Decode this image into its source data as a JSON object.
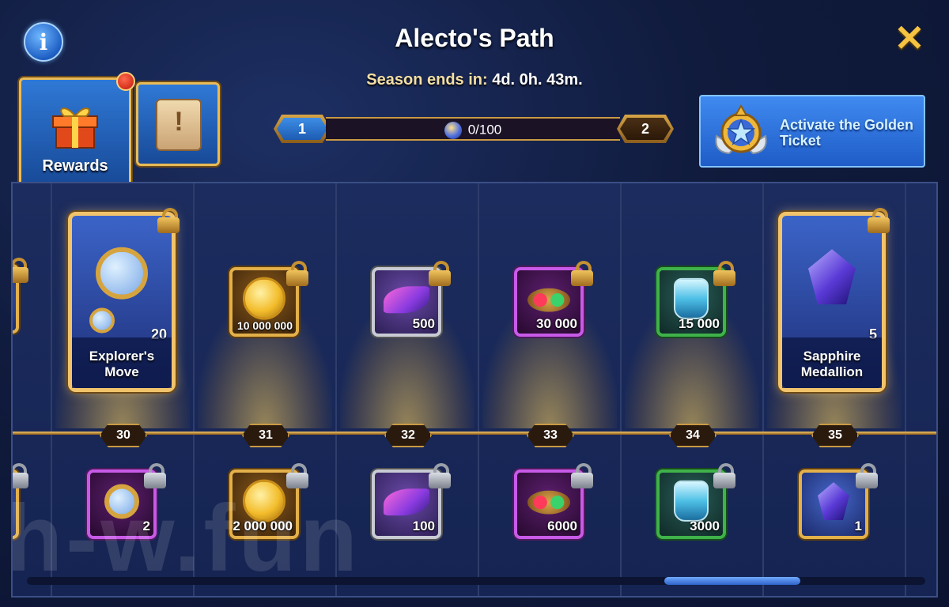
{
  "header": {
    "title": "Alecto's Path",
    "season_label": "Season ends in:",
    "season_time": "4d. 0h. 43m."
  },
  "tabs": {
    "rewards_label": "Rewards"
  },
  "progress": {
    "current_level": "1",
    "next_level": "2",
    "points_text": "0/100",
    "fraction": 0.0
  },
  "golden_ticket": {
    "label": "Activate the Golden Ticket"
  },
  "levels": [
    "30",
    "31",
    "32",
    "33",
    "34",
    "35"
  ],
  "golden_row": {
    "explorers_move": {
      "name": "Explorer's Move",
      "qty": "20"
    },
    "gold": {
      "qty": "10 000 000"
    },
    "fragment": {
      "qty": "500"
    },
    "amulet": {
      "qty": "30 000"
    },
    "potion": {
      "qty": "15 000"
    },
    "sapphire": {
      "name": "Sapphire Medallion",
      "qty": "5"
    }
  },
  "free_row": {
    "glass": {
      "qty": "2"
    },
    "gold": {
      "qty": "2 000 000"
    },
    "fragment": {
      "qty": "100"
    },
    "amulet": {
      "qty": "6000"
    },
    "potion": {
      "qty": "3000"
    },
    "sapphire": {
      "qty": "1"
    }
  },
  "watermark": "h-w.fun",
  "colors": {
    "accent_gold": "#e3b04a",
    "button_blue": "#2f79d6"
  }
}
